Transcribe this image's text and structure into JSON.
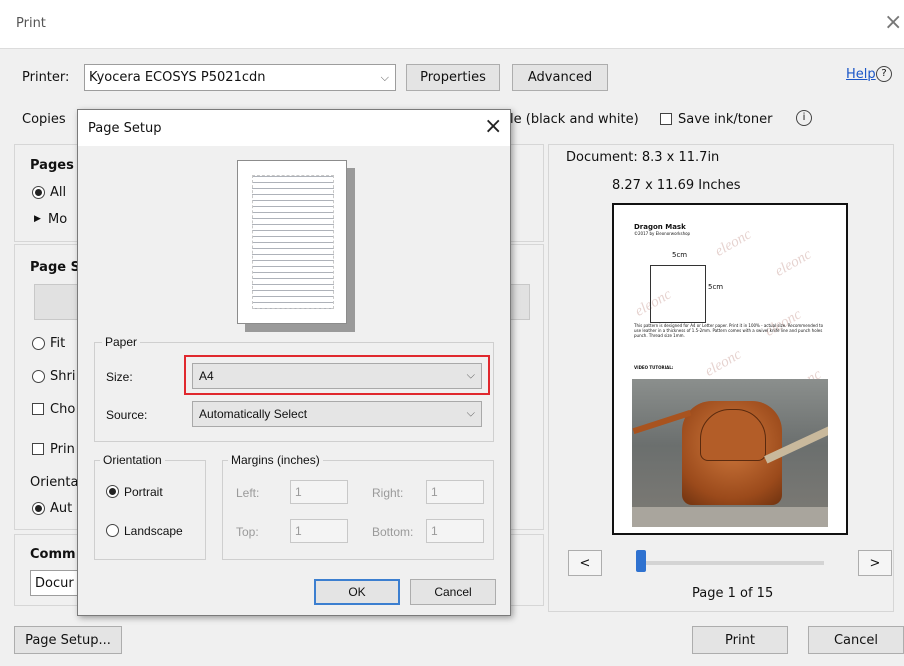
{
  "window": {
    "title": "Print",
    "close_glyph": "×"
  },
  "printer": {
    "label": "Printer:",
    "selected": "Kyocera ECOSYS P5021cdn",
    "properties": "Properties",
    "advanced": "Advanced",
    "help": "Help",
    "help_icon": "?"
  },
  "copies": {
    "label": "Copies",
    "grayscale_label": "le (black and white)",
    "save_ink_label": "Save ink/toner",
    "info_icon": "i"
  },
  "left": {
    "pages_label": "Pages t",
    "all_label": "All",
    "more_label": "Mo",
    "page_sizing_label": "Page S",
    "fit_label": "Fit",
    "shrink_label": "Shri",
    "choose_label": "Cho",
    "print_label": "Prin",
    "orientation_label": "Orienta",
    "auto_label": "Aut",
    "comments_label": "Comm",
    "comments_value": "Docur"
  },
  "preview": {
    "document_label": "Document: 8.3 x 11.7in",
    "paper_size": "8.27 x 11.69 Inches",
    "page_status": "Page 1 of 15",
    "prev_glyph": "<",
    "next_glyph": ">",
    "slider_position": 0.0,
    "doc_title": "Dragon Mask",
    "doc_subtitle": "©2017 by Eleonorworkshop",
    "dim_top": "5cm",
    "dim_side": "5cm",
    "doc_text": "This pattern is designed for A4 or Letter paper. Print it in 100% - actual size. Recommended to use leather in a thickness of 1.5-2mm. Pattern comes with a swivel knife line and punch holes punch. Thread size 1mm.",
    "video_label": "VIDEO TUTORIAL:",
    "watermark": "eleonc"
  },
  "footer": {
    "page_setup": "Page Setup...",
    "print": "Print",
    "cancel": "Cancel"
  },
  "dialog": {
    "title": "Page Setup",
    "close_glyph": "×",
    "paper_group": "Paper",
    "size_label": "Size:",
    "size_value": "A4",
    "source_label": "Source:",
    "source_value": "Automatically Select",
    "orientation_group": "Orientation",
    "portrait": "Portrait",
    "landscape": "Landscape",
    "margins_group": "Margins (inches)",
    "left_label": "Left:",
    "left_value": "1",
    "right_label": "Right:",
    "right_value": "1",
    "top_label": "Top:",
    "top_value": "1",
    "bottom_label": "Bottom:",
    "bottom_value": "1",
    "ok": "OK",
    "cancel": "Cancel",
    "highlight_color": "#e0282e"
  }
}
